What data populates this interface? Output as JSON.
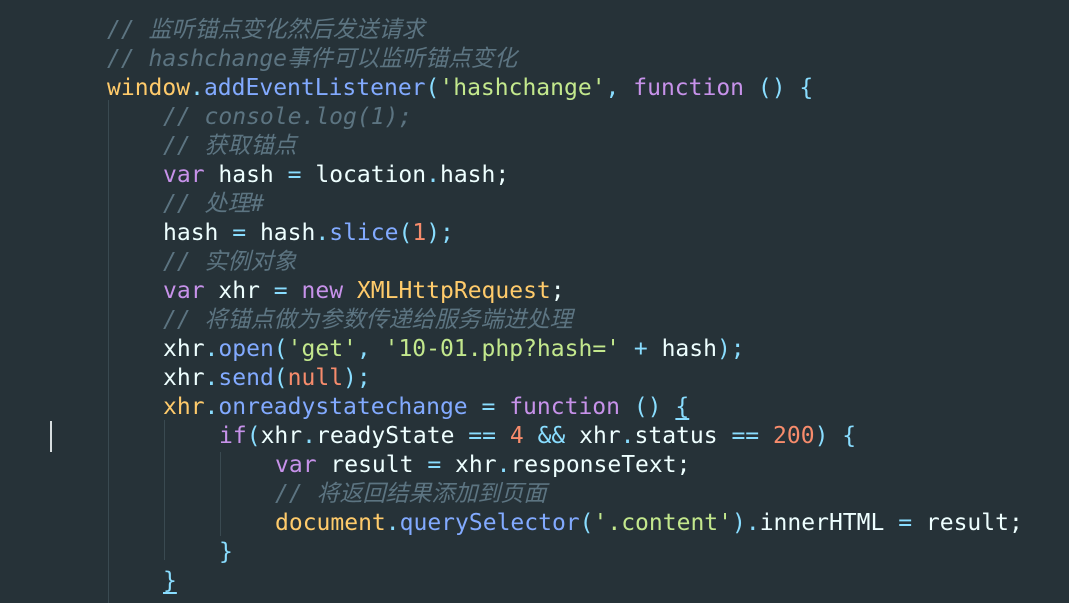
{
  "editor": {
    "theme_colors": {
      "background": "#263238",
      "comment": "#5c7481",
      "keyword": "#c792ea",
      "plain": "#eeffff",
      "string": "#c3e88d",
      "number": "#f78c6c",
      "function": "#82aaff",
      "punct": "#89ddff",
      "global": "#ffcb6b"
    },
    "lines": [
      {
        "indent": 0,
        "tokens": [
          {
            "text": "// 监听锚点变化然后发送请求",
            "c": "comment",
            "italic": true
          }
        ]
      },
      {
        "indent": 0,
        "tokens": [
          {
            "text": "// hashchange事件可以监听锚点变化",
            "c": "comment",
            "italic": true
          }
        ]
      },
      {
        "indent": 0,
        "tokens": [
          {
            "text": "window",
            "c": "global"
          },
          {
            "text": ".",
            "c": "punct"
          },
          {
            "text": "addEventListener",
            "c": "function"
          },
          {
            "text": "(",
            "c": "punct"
          },
          {
            "text": "'hashchange'",
            "c": "string"
          },
          {
            "text": ", ",
            "c": "punct"
          },
          {
            "text": "function",
            "c": "keyword"
          },
          {
            "text": " () {",
            "c": "punct"
          }
        ]
      },
      {
        "indent": 1,
        "tokens": [
          {
            "text": "// console.log(1);",
            "c": "comment",
            "italic": true
          }
        ]
      },
      {
        "indent": 1,
        "tokens": [
          {
            "text": "// 获取锚点",
            "c": "comment",
            "italic": true
          }
        ]
      },
      {
        "indent": 1,
        "tokens": [
          {
            "text": "var",
            "c": "keyword"
          },
          {
            "text": " hash ",
            "c": "plain"
          },
          {
            "text": "=",
            "c": "punct"
          },
          {
            "text": " location",
            "c": "plain"
          },
          {
            "text": ".",
            "c": "punct"
          },
          {
            "text": "hash;",
            "c": "plain"
          }
        ]
      },
      {
        "indent": 1,
        "tokens": [
          {
            "text": "// 处理#",
            "c": "comment",
            "italic": true
          }
        ]
      },
      {
        "indent": 1,
        "tokens": [
          {
            "text": "hash ",
            "c": "plain"
          },
          {
            "text": "=",
            "c": "punct"
          },
          {
            "text": " hash",
            "c": "plain"
          },
          {
            "text": ".",
            "c": "punct"
          },
          {
            "text": "slice",
            "c": "function"
          },
          {
            "text": "(",
            "c": "punct"
          },
          {
            "text": "1",
            "c": "number"
          },
          {
            "text": ");",
            "c": "punct"
          }
        ]
      },
      {
        "indent": 1,
        "tokens": [
          {
            "text": "// 实例对象",
            "c": "comment",
            "italic": true
          }
        ]
      },
      {
        "indent": 1,
        "tokens": [
          {
            "text": "var",
            "c": "keyword"
          },
          {
            "text": " xhr ",
            "c": "plain"
          },
          {
            "text": "=",
            "c": "punct"
          },
          {
            "text": " ",
            "c": "plain"
          },
          {
            "text": "new",
            "c": "keyword"
          },
          {
            "text": " ",
            "c": "plain"
          },
          {
            "text": "XMLHttpRequest",
            "c": "global"
          },
          {
            "text": ";",
            "c": "plain"
          }
        ]
      },
      {
        "indent": 1,
        "tokens": [
          {
            "text": "// 将锚点做为参数传递给服务端进处理",
            "c": "comment",
            "italic": true
          }
        ]
      },
      {
        "indent": 1,
        "tokens": [
          {
            "text": "xhr",
            "c": "plain"
          },
          {
            "text": ".",
            "c": "punct"
          },
          {
            "text": "open",
            "c": "function"
          },
          {
            "text": "(",
            "c": "punct"
          },
          {
            "text": "'get'",
            "c": "string"
          },
          {
            "text": ", ",
            "c": "punct"
          },
          {
            "text": "'10-01.php?hash='",
            "c": "string"
          },
          {
            "text": " + ",
            "c": "punct"
          },
          {
            "text": "hash",
            "c": "plain"
          },
          {
            "text": ");",
            "c": "punct"
          }
        ]
      },
      {
        "indent": 1,
        "tokens": [
          {
            "text": "xhr",
            "c": "plain"
          },
          {
            "text": ".",
            "c": "punct"
          },
          {
            "text": "send",
            "c": "function"
          },
          {
            "text": "(",
            "c": "punct"
          },
          {
            "text": "null",
            "c": "number"
          },
          {
            "text": ");",
            "c": "punct"
          }
        ]
      },
      {
        "indent": 1,
        "tokens": [
          {
            "text": "xhr",
            "c": "global"
          },
          {
            "text": ".",
            "c": "punct"
          },
          {
            "text": "onreadystatechange",
            "c": "function"
          },
          {
            "text": " = ",
            "c": "punct"
          },
          {
            "text": "function",
            "c": "keyword"
          },
          {
            "text": " () ",
            "c": "punct"
          },
          {
            "text": "{",
            "c": "punct",
            "underline": true
          }
        ]
      },
      {
        "indent": 2,
        "tokens": [
          {
            "text": "if",
            "c": "keyword"
          },
          {
            "text": "(",
            "c": "punct"
          },
          {
            "text": "xhr",
            "c": "plain"
          },
          {
            "text": ".",
            "c": "punct"
          },
          {
            "text": "readyState ",
            "c": "plain"
          },
          {
            "text": "==",
            "c": "punct"
          },
          {
            "text": " ",
            "c": "plain"
          },
          {
            "text": "4",
            "c": "number"
          },
          {
            "text": " && ",
            "c": "punct"
          },
          {
            "text": "xhr",
            "c": "plain"
          },
          {
            "text": ".",
            "c": "punct"
          },
          {
            "text": "status ",
            "c": "plain"
          },
          {
            "text": "==",
            "c": "punct"
          },
          {
            "text": " ",
            "c": "plain"
          },
          {
            "text": "200",
            "c": "number"
          },
          {
            "text": ") {",
            "c": "punct"
          }
        ]
      },
      {
        "indent": 3,
        "tokens": [
          {
            "text": "var",
            "c": "keyword"
          },
          {
            "text": " result ",
            "c": "plain"
          },
          {
            "text": "=",
            "c": "punct"
          },
          {
            "text": " xhr",
            "c": "plain"
          },
          {
            "text": ".",
            "c": "punct"
          },
          {
            "text": "responseText;",
            "c": "plain"
          }
        ]
      },
      {
        "indent": 3,
        "tokens": [
          {
            "text": "// 将返回结果添加到页面",
            "c": "comment",
            "italic": true
          }
        ]
      },
      {
        "indent": 3,
        "tokens": [
          {
            "text": "document",
            "c": "global"
          },
          {
            "text": ".",
            "c": "punct"
          },
          {
            "text": "querySelector",
            "c": "function"
          },
          {
            "text": "(",
            "c": "punct"
          },
          {
            "text": "'.content'",
            "c": "string"
          },
          {
            "text": ").",
            "c": "punct"
          },
          {
            "text": "innerHTML ",
            "c": "plain"
          },
          {
            "text": "=",
            "c": "punct"
          },
          {
            "text": " result;",
            "c": "plain"
          }
        ]
      },
      {
        "indent": 2,
        "tokens": [
          {
            "text": "}",
            "c": "punct"
          }
        ]
      },
      {
        "indent": 1,
        "tokens": [
          {
            "text": "}",
            "c": "punct",
            "underline": true
          }
        ]
      }
    ]
  }
}
